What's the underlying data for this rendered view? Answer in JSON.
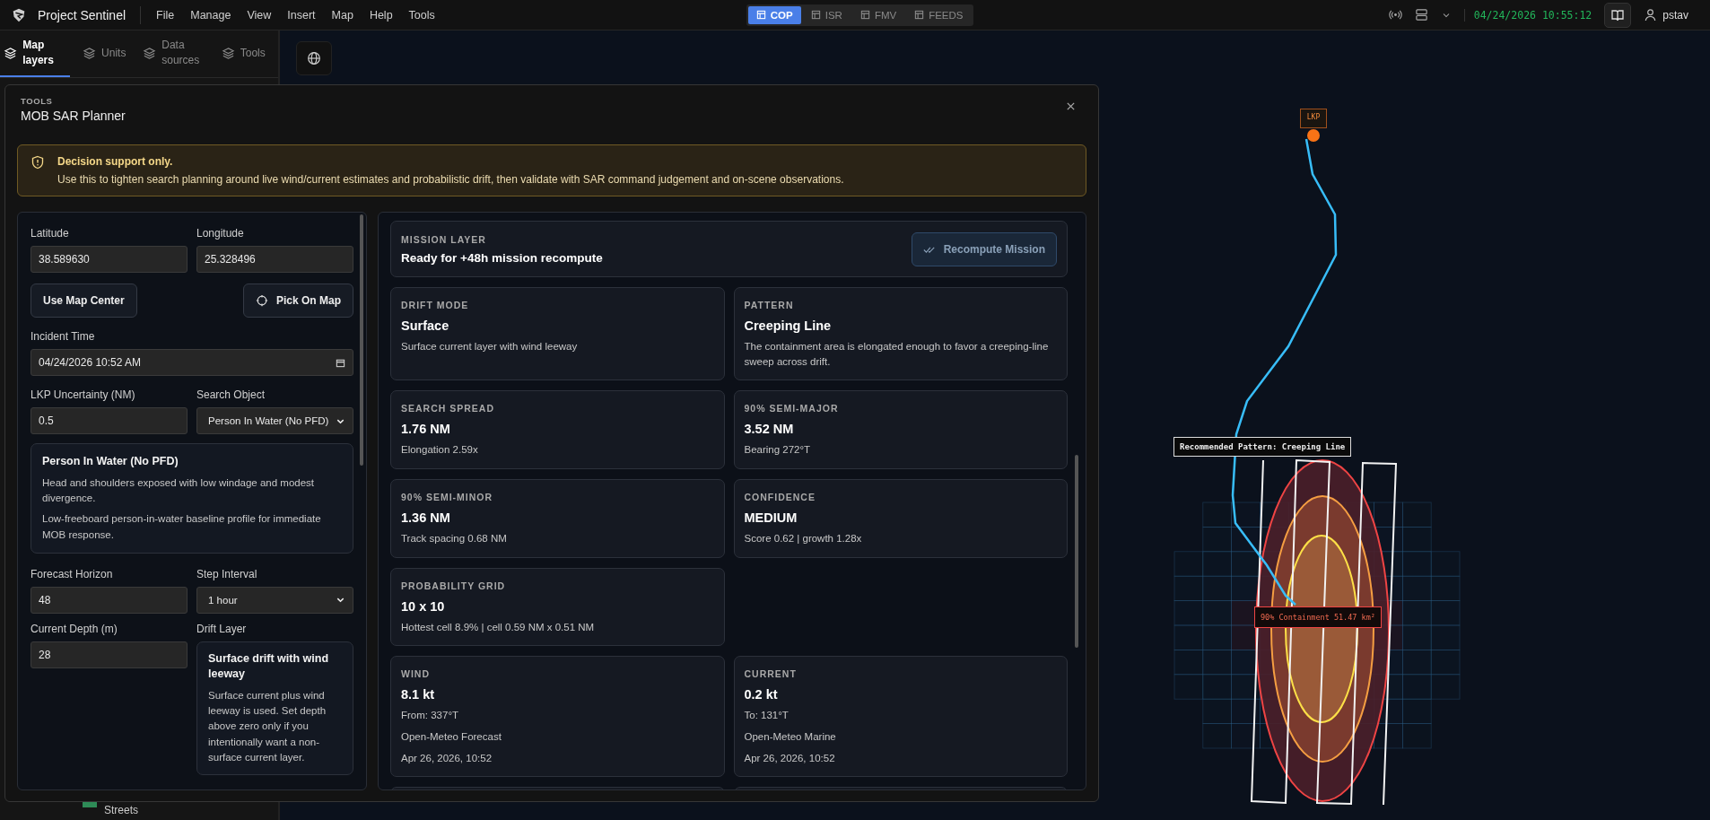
{
  "app": {
    "title": "Project Sentinel"
  },
  "menu": [
    "File",
    "Manage",
    "View",
    "Insert",
    "Map",
    "Help",
    "Tools"
  ],
  "view_tabs": [
    {
      "label": "COP",
      "selected": true
    },
    {
      "label": "ISR",
      "selected": false
    },
    {
      "label": "FMV",
      "selected": false
    },
    {
      "label": "FEEDS",
      "selected": false
    }
  ],
  "status": {
    "clock": "04/24/2026 10:55:12",
    "user": "pstav"
  },
  "sidebar": {
    "tabs": [
      {
        "label": "Map layers",
        "selected": true
      },
      {
        "label": "Units",
        "selected": false
      },
      {
        "label": "Data sources",
        "selected": false
      },
      {
        "label": "Tools",
        "selected": false
      }
    ],
    "bottom_layer": "Streets"
  },
  "map": {
    "lkp_label": "LKP",
    "pattern_label": "Recommended Pattern: Creeping Line",
    "containment_label": "90% Containment 51.47 km²"
  },
  "dialog": {
    "eyebrow": "TOOLS",
    "title": "MOB SAR Planner",
    "alert": {
      "title": "Decision support only.",
      "text": "Use this to tighten search planning around live wind/current estimates and probabilistic drift, then validate with SAR command judgement and on-scene observations."
    },
    "form": {
      "latitude": {
        "label": "Latitude",
        "value": "38.589630"
      },
      "longitude": {
        "label": "Longitude",
        "value": "25.328496"
      },
      "use_center": "Use Map Center",
      "pick_on_map": "Pick On Map",
      "incident_time": {
        "label": "Incident Time",
        "value": "04/24/2026 10:52 AM"
      },
      "lkp_uncertainty": {
        "label": "LKP Uncertainty (NM)",
        "value": "0.5"
      },
      "search_object": {
        "label": "Search Object",
        "value": "Person In Water (No PFD)"
      },
      "object_info": {
        "title": "Person In Water (No PFD)",
        "paragraphs": [
          "Head and shoulders exposed with low windage and modest divergence.",
          "Low-freeboard person-in-water baseline profile for immediate MOB response."
        ]
      },
      "forecast_horizon": {
        "label": "Forecast Horizon",
        "value": "48"
      },
      "step_interval": {
        "label": "Step Interval",
        "value": "1 hour"
      },
      "current_depth": {
        "label": "Current Depth (m)",
        "value": "28"
      },
      "drift_layer": {
        "label": "Drift Layer",
        "title": "Surface drift with wind leeway",
        "text": "Surface current plus wind leeway is used. Set depth above zero only if you intentionally want a non-surface current layer."
      }
    },
    "mission": {
      "eyebrow": "MISSION LAYER",
      "status": "Ready for +48h mission recompute",
      "button": "Recompute Mission"
    },
    "card_rows": [
      [
        {
          "label": "DRIFT MODE",
          "value": "Surface",
          "notes": [
            "Surface current layer with wind leeway"
          ]
        },
        {
          "label": "PATTERN",
          "value": "Creeping Line",
          "notes": [
            "The containment area is elongated enough to favor a creeping-line sweep across drift."
          ]
        }
      ],
      [
        {
          "label": "SEARCH SPREAD",
          "value": "1.76 NM",
          "notes": [
            "Elongation 2.59x"
          ]
        },
        {
          "label": "90% SEMI-MAJOR",
          "value": "3.52 NM",
          "notes": [
            "Bearing 272°T"
          ]
        }
      ],
      [
        {
          "label": "90% SEMI-MINOR",
          "value": "1.36 NM",
          "notes": [
            "Track spacing 0.68 NM"
          ]
        },
        {
          "label": "CONFIDENCE",
          "value": "MEDIUM",
          "notes": [
            "Score 0.62 | growth 1.28x"
          ]
        }
      ],
      [
        {
          "label": "PROBABILITY GRID",
          "value": "10 x 10",
          "notes": [
            "Hottest cell 8.9% | cell 0.59 NM x 0.51 NM"
          ]
        }
      ],
      [
        {
          "label": "WIND",
          "value": "8.1 kt",
          "notes": [
            "From: 337°T",
            "Open-Meteo Forecast",
            "Apr 26, 2026, 10:52"
          ]
        },
        {
          "label": "CURRENT",
          "value": "0.2 kt",
          "notes": [
            "To: 131°T",
            "Open-Meteo Marine",
            "Apr 26, 2026, 10:52"
          ]
        }
      ]
    ]
  }
}
